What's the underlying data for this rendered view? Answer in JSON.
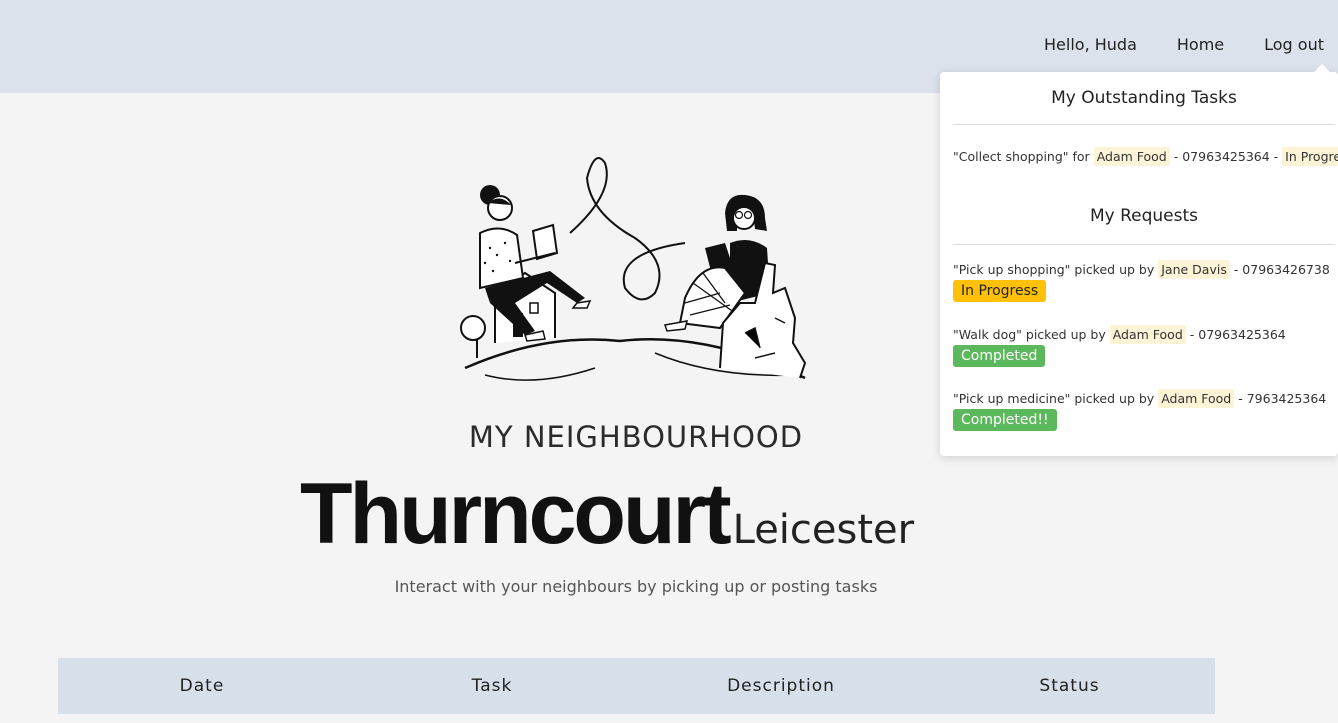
{
  "nav": {
    "greeting": "Hello, Huda",
    "home": "Home",
    "logout": "Log out"
  },
  "hero": {
    "neighbourhood_label": "MY NEIGHBOURHOOD",
    "area_name": "Thurncourt",
    "city": "Leicester",
    "tagline": "Interact with your neighbours by picking up or posting tasks",
    "illustration": "neighbours-illustration"
  },
  "table": {
    "headers": [
      "Date",
      "Task",
      "Description",
      "Status"
    ]
  },
  "dropdown": {
    "outstanding_title": "My Outstanding Tasks",
    "outstanding": [
      {
        "task": "\"Collect shopping\" for",
        "person": "Adam Food",
        "phone": "- 07963425364 -",
        "status": "In Progress"
      }
    ],
    "requests_title": "My Requests",
    "requests": [
      {
        "task": "\"Pick up shopping\" picked up by",
        "person": "Jane Davis",
        "phone": "- 07963426738",
        "status": "In Progress",
        "status_color": "#ffc107"
      },
      {
        "task": "\"Walk dog\" picked up by",
        "person": "Adam Food",
        "phone": "- 07963425364",
        "status": "Completed",
        "status_color": "#5cb85c"
      },
      {
        "task": "\"Pick up medicine\" picked up by",
        "person": "Adam Food",
        "phone": "- 7963425364",
        "status": "Completed!!",
        "status_color": "#5cb85c"
      }
    ]
  }
}
